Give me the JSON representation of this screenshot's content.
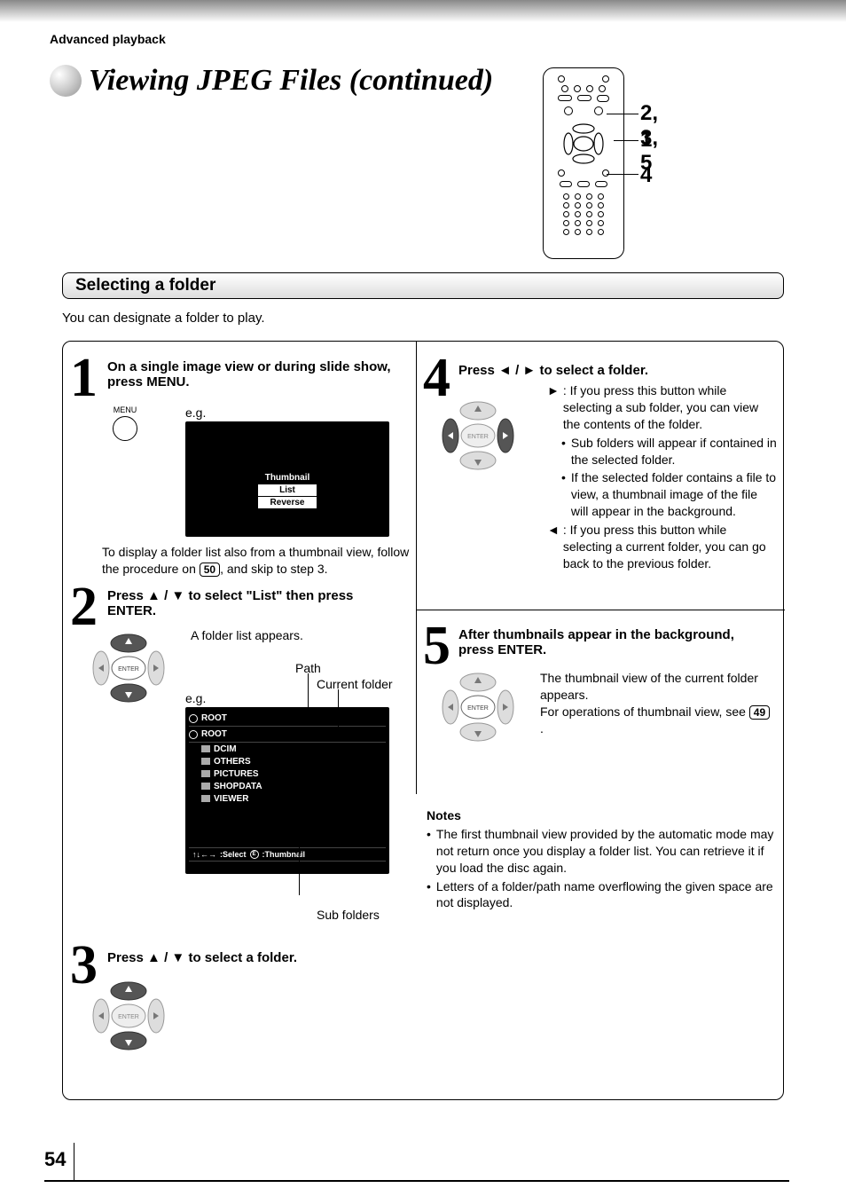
{
  "header": {
    "section": "Advanced playback"
  },
  "title": "Viewing JPEG Files (continued)",
  "remote": {
    "label_top": "2, 3, 5",
    "label_mid": "1",
    "label_bot": "4"
  },
  "section_bar": "Selecting a folder",
  "intro": "You can designate a folder to play.",
  "step1": {
    "num": "1",
    "head": "On a single image view or during slide show, press MENU.",
    "menu_label": "MENU",
    "eg": "e.g.",
    "menu_options": {
      "a": "Thumbnail",
      "b": "List",
      "c": "Reverse"
    },
    "note_a": "To display a folder list also from a thumbnail view, follow the procedure on ",
    "pref": "50",
    "note_b": ", and skip to step 3."
  },
  "step2": {
    "num": "2",
    "head_a": "Press ",
    "head_b": " / ",
    "head_c": " to select \"List\" then press ENTER.",
    "result": "A folder list appears.",
    "eg": "e.g.",
    "path_label": "Path",
    "current_label": "Current folder",
    "sub_label": "Sub folders",
    "folder_root": "ROOT",
    "folder_items": {
      "a": "DCIM",
      "b": "OTHERS",
      "c": "PICTURES",
      "d": "SHOPDATA",
      "e": "VIEWER"
    },
    "hint_select": ":Select",
    "hint_thumb": ":Thumbnail",
    "enter_label": "ENTER"
  },
  "step3": {
    "num": "3",
    "head_a": "Press ",
    "head_b": " / ",
    "head_c": " to select a folder.",
    "enter_label": "ENTER"
  },
  "step4": {
    "num": "4",
    "head_a": "Press ",
    "head_b": " / ",
    "head_c": " to select a folder.",
    "enter_label": "ENTER",
    "bullet_r": ": If you press this button while selecting a sub folder, you can view the contents of the folder.",
    "bullet_r_sub1": "Sub folders will appear if contained in the selected folder.",
    "bullet_r_sub2": "If the selected folder contains a file to view, a thumbnail image of the file will appear in the background.",
    "bullet_l": ": If you press this button while selecting a current folder, you can go back to the previous folder."
  },
  "step5": {
    "num": "5",
    "head": "After thumbnails appear in the background, press ENTER.",
    "enter_label": "ENTER",
    "body_a": "The thumbnail view of the current folder appears.",
    "body_b": "For operations of thumbnail view, see ",
    "pref": "49",
    "body_c": "."
  },
  "notes": {
    "title": "Notes",
    "n1": "The first thumbnail view provided by the automatic mode may not return once you display a folder list. You can retrieve it if you load the disc again.",
    "n2": "Letters of a folder/path name overflowing the given space are not displayed."
  },
  "page_number": "54",
  "glyphs": {
    "up": "▲",
    "down": "▼",
    "left": "◄",
    "right": "►"
  }
}
